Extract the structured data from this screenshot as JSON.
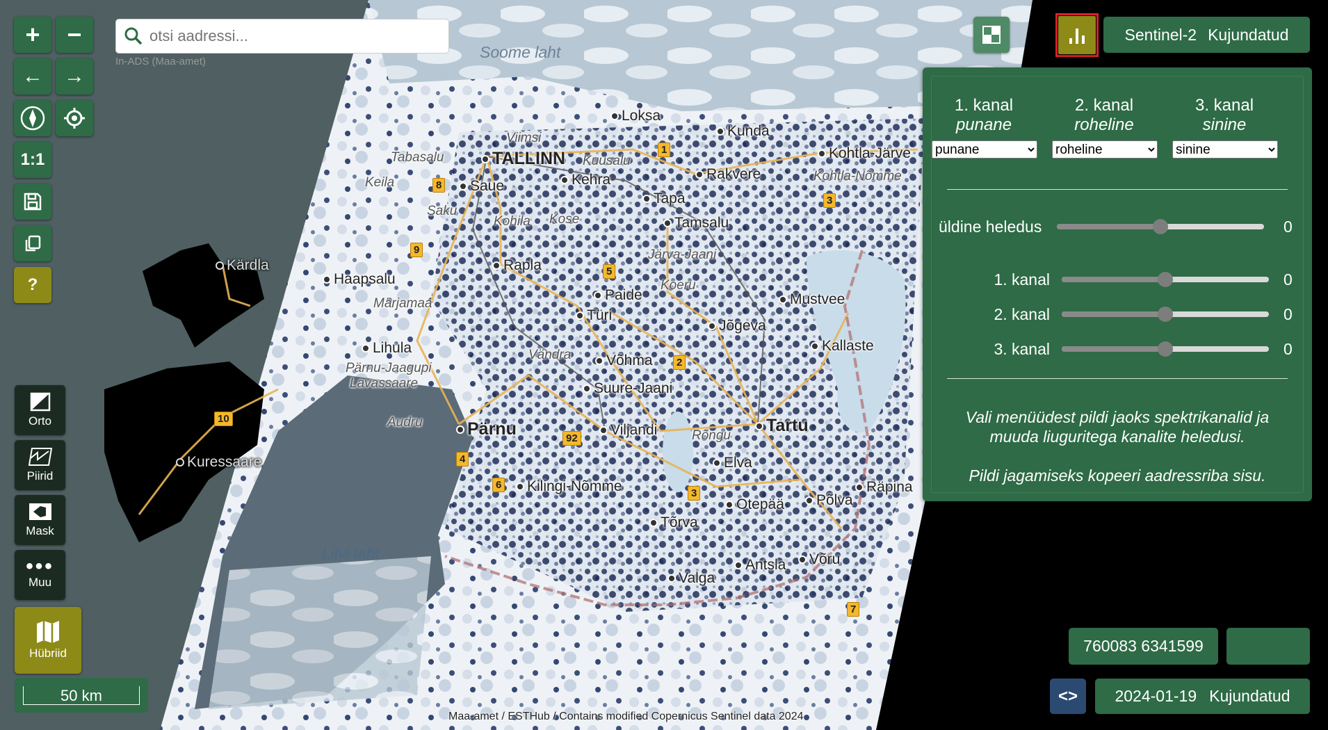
{
  "search": {
    "placeholder": "otsi aadressi...",
    "source": "In-ADS (Maa-amet)"
  },
  "controls": {
    "zoom_in": "+",
    "zoom_out": "−",
    "back": "←",
    "forward": "→",
    "scale_1_1": "1:1",
    "help": "?"
  },
  "layers": [
    {
      "label": "Orto",
      "icon": "ortho-icon"
    },
    {
      "label": "Piirid",
      "icon": "borders-icon"
    },
    {
      "label": "Mask",
      "icon": "mask-icon"
    },
    {
      "label": "Muu",
      "icon": "more-icon"
    },
    {
      "label": "Hübriid",
      "icon": "map-icon"
    }
  ],
  "scale_bar": "50 km",
  "top_right": {
    "product": "Sentinel-2",
    "mode": "Kujundatud"
  },
  "panel": {
    "channels": [
      {
        "title": "1. kanal",
        "color": "punane",
        "selected": "punane"
      },
      {
        "title": "2. kanal",
        "color": "roheline",
        "selected": "roheline"
      },
      {
        "title": "3. kanal",
        "color": "sinine",
        "selected": "sinine"
      }
    ],
    "brightness_label": "üldine heledus",
    "brightness_value": "0",
    "brightness_level": 0.5,
    "channel_sliders": [
      {
        "label": "1. kanal",
        "value": "0",
        "level": 0.5
      },
      {
        "label": "2. kanal",
        "value": "0",
        "level": 0.5
      },
      {
        "label": "3. kanal",
        "value": "0",
        "level": 0.5
      }
    ],
    "help1a": "Vali menüüdest pildi jaoks spektrikanalid ja",
    "help1b": "muuda liuguritega kanalite heledusi.",
    "help2": "Pildi jagamiseks kopeeri aadressriba sisu."
  },
  "coords": "760083 6341599",
  "bottom_right": {
    "date": "2024-01-19",
    "mode": "Kujundatud"
  },
  "attribution": "Maa-amet  /  ESTHub  /   Contains modified Copernicus Sentinel data 2024",
  "map": {
    "places": [
      {
        "n": "Loksa",
        "c": "dot"
      },
      {
        "n": "Kunda",
        "c": "dot"
      },
      {
        "n": "Viimsi",
        "c": "minor"
      },
      {
        "n": "TALLINN",
        "c": "dot big"
      },
      {
        "n": "Tabasalu",
        "c": "minor"
      },
      {
        "n": "Kuusalu",
        "c": "minor"
      },
      {
        "n": "Kohtla-Järve",
        "c": "dot"
      },
      {
        "n": "Kohtla-Nõmme",
        "c": "minor"
      },
      {
        "n": "Saue",
        "c": "dot"
      },
      {
        "n": "Keila",
        "c": "minor"
      },
      {
        "n": "Kehra",
        "c": "dot"
      },
      {
        "n": "Rakvere",
        "c": "dot"
      },
      {
        "n": "Tapa",
        "c": "dot"
      },
      {
        "n": "Saku",
        "c": "minor"
      },
      {
        "n": "Kohila",
        "c": "minor"
      },
      {
        "n": "Kose",
        "c": "minor"
      },
      {
        "n": "Tamsalu",
        "c": "dot"
      },
      {
        "n": "Kärdla",
        "c": "dot dark"
      },
      {
        "n": "Järva-Jaani",
        "c": "minor"
      },
      {
        "n": "Haapsalu",
        "c": "dot"
      },
      {
        "n": "Rapla",
        "c": "dot"
      },
      {
        "n": "Koeru",
        "c": "minor"
      },
      {
        "n": "Paide",
        "c": "dot"
      },
      {
        "n": "Märjamaa",
        "c": "minor"
      },
      {
        "n": "Mustvee",
        "c": "dot"
      },
      {
        "n": "Türi",
        "c": "dot"
      },
      {
        "n": "Jõgeva",
        "c": "dot"
      },
      {
        "n": "Lihula",
        "c": "dot"
      },
      {
        "n": "Kallaste",
        "c": "dot"
      },
      {
        "n": "Vändra",
        "c": "minor"
      },
      {
        "n": "Võhma",
        "c": "dot"
      },
      {
        "n": "Pärnu-Jaagupi",
        "c": "minor"
      },
      {
        "n": "Lavassaare",
        "c": "minor"
      },
      {
        "n": "Suure-Jaani",
        "c": "dot"
      },
      {
        "n": "Audru",
        "c": "minor"
      },
      {
        "n": "Pärnu",
        "c": "dot big"
      },
      {
        "n": "Tartu",
        "c": "dot big"
      },
      {
        "n": "Viljandi",
        "c": "dot"
      },
      {
        "n": "Rõngu",
        "c": "minor"
      },
      {
        "n": "Kuressaare",
        "c": "dot dark"
      },
      {
        "n": "Elva",
        "c": "dot"
      },
      {
        "n": "Kilingi-Nõmme",
        "c": "dot"
      },
      {
        "n": "Räpina",
        "c": "dot"
      },
      {
        "n": "Otepää",
        "c": "dot"
      },
      {
        "n": "Põlva",
        "c": "dot"
      },
      {
        "n": "Tõrva",
        "c": "dot"
      },
      {
        "n": "Võru",
        "c": "dot"
      },
      {
        "n": "Antsla",
        "c": "dot"
      },
      {
        "n": "Valga",
        "c": "dot"
      }
    ],
    "sea_labels": [
      "Liivi laht",
      "Soome laht"
    ],
    "road_numbers": [
      "1",
      "8",
      "3",
      "9",
      "5",
      "2",
      "10",
      "92",
      "4",
      "6",
      "3",
      "7"
    ]
  }
}
